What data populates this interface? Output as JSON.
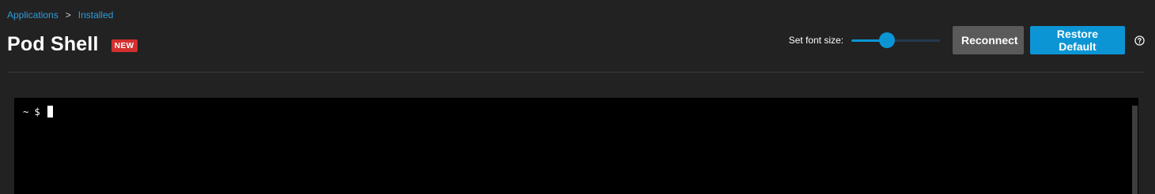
{
  "breadcrumb": {
    "items": [
      {
        "label": "Applications"
      },
      {
        "label": "Installed"
      }
    ],
    "separator": ">"
  },
  "header": {
    "title": "Pod Shell",
    "badge": "NEW"
  },
  "controls": {
    "font_size_label": "Set font size:",
    "font_size_slider_fraction": 0.4,
    "reconnect_label": "Reconnect",
    "restore_default_label": "Restore Default",
    "help_icon": "help-circle-icon"
  },
  "terminal": {
    "prompt": "~ $ "
  },
  "colors": {
    "background": "#222222",
    "accent": "#0c95d4",
    "link": "#2d9cdb",
    "badge": "#d32f2f",
    "button_secondary": "#5a5a5a",
    "terminal_bg": "#000000"
  }
}
